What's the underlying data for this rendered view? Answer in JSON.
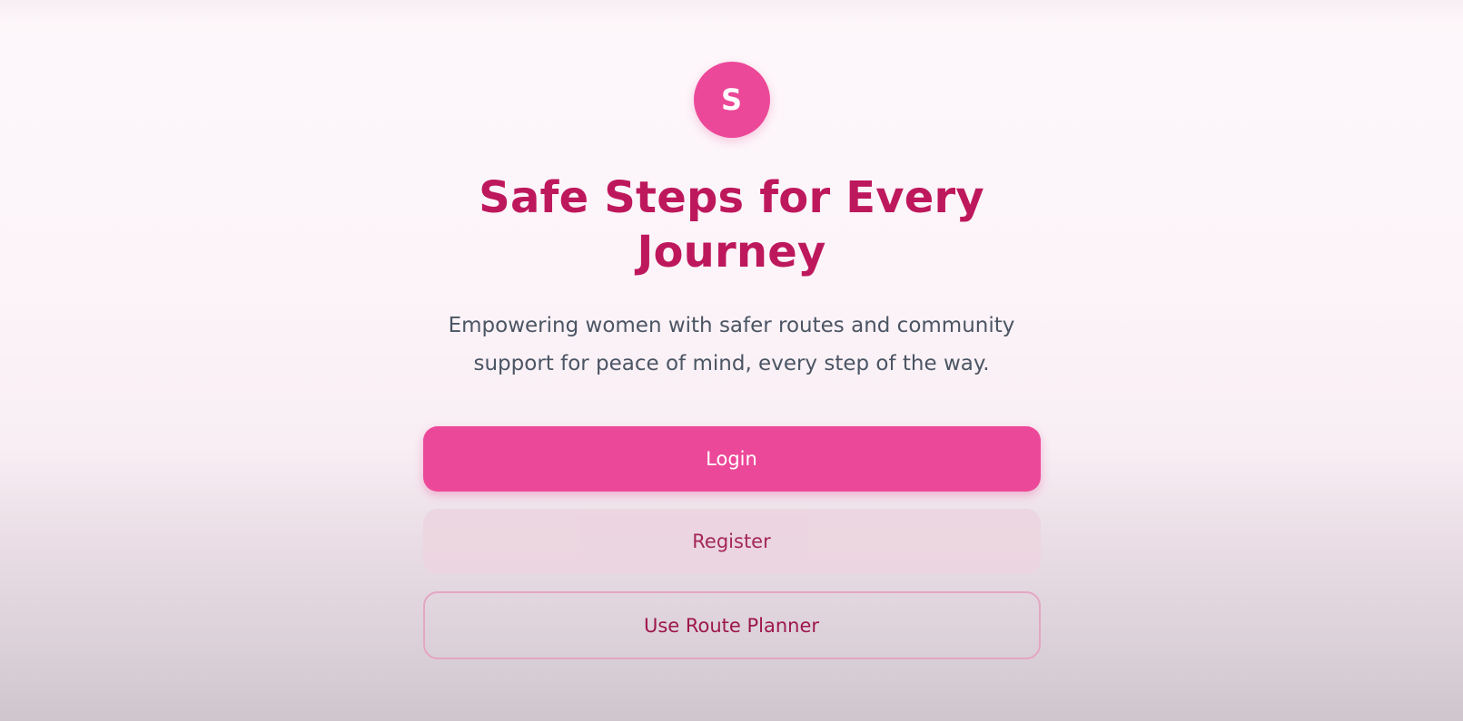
{
  "logo": {
    "letter": "S"
  },
  "hero": {
    "title": "Safe Steps for Every Journey",
    "subtitle": "Empowering women with safer routes and community support for peace of mind, every step of the way."
  },
  "actions": {
    "login_label": "Login",
    "register_label": "Register",
    "route_planner_label": "Use Route Planner"
  },
  "colors": {
    "accent": "#ec4899",
    "title": "#be185d",
    "secondary_text": "#9d174d",
    "body_text": "#4b5563"
  }
}
